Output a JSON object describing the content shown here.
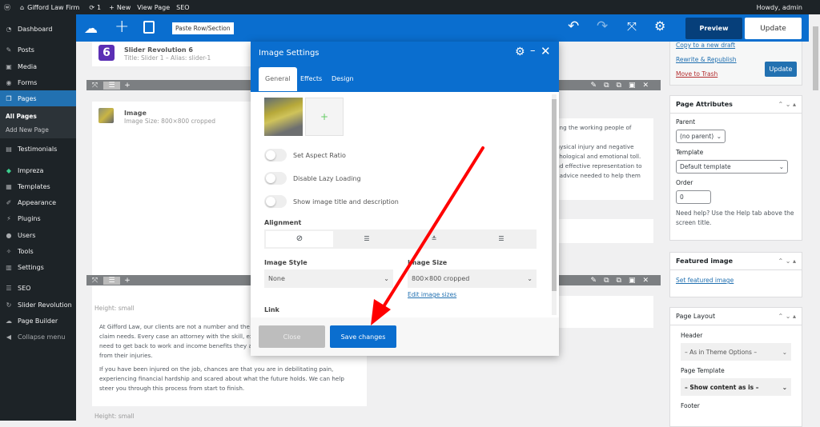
{
  "adminbar": {
    "site": "Gifford Law Firm",
    "updates": "1",
    "new": "New",
    "view": "View Page",
    "seo": "SEO",
    "howdy": "Howdy, admin"
  },
  "sidebar": {
    "items": [
      {
        "label": "Dashboard",
        "icon": "dashboard-icon"
      },
      {
        "label": "Posts",
        "icon": "pin-icon"
      },
      {
        "label": "Media",
        "icon": "media-icon"
      },
      {
        "label": "Forms",
        "icon": "forms-icon"
      },
      {
        "label": "Pages",
        "icon": "pages-icon"
      },
      {
        "label": "Testimonials",
        "icon": "testimonials-icon"
      },
      {
        "label": "Impreza",
        "icon": "diamond-icon"
      },
      {
        "label": "Templates",
        "icon": "templates-icon"
      },
      {
        "label": "Appearance",
        "icon": "brush-icon"
      },
      {
        "label": "Plugins",
        "icon": "plugin-icon"
      },
      {
        "label": "Users",
        "icon": "users-icon"
      },
      {
        "label": "Tools",
        "icon": "wrench-icon"
      },
      {
        "label": "Settings",
        "icon": "settings-icon"
      },
      {
        "label": "SEO",
        "icon": "seo-icon"
      },
      {
        "label": "Slider Revolution",
        "icon": "slider-icon"
      },
      {
        "label": "Page Builder",
        "icon": "builder-icon"
      },
      {
        "label": "Collapse menu",
        "icon": "collapse-icon"
      }
    ],
    "sub": [
      "All Pages",
      "Add New Page"
    ]
  },
  "toolbar": {
    "paste": "Paste Row/Section",
    "preview": "Preview",
    "update": "Update",
    "accent": "#0a6ecf"
  },
  "canvas": {
    "slider": {
      "title": "Slider Revolution 6",
      "sub": "Title: Slider 1 – Alias: slider-1",
      "badge": "6"
    },
    "image": {
      "title": "Image",
      "sub": "Image Size: 800×800 cropped"
    },
    "right_text": [
      "sting the working people of",
      "physical injury and negative",
      "ychological and emotional toll.",
      "and effective representation to",
      "al advice needed to help them"
    ],
    "height_label": "Height: small",
    "para1": "At Gifford Law, our clients are not a number and the foc the individualized attention their claim needs. Every case an attorney with the skill, experience and reputation to h they need to get back to work and income benefits they are entitled to while they recover from their injuries.",
    "para2": "If you have been injured on the job, chances are that you are in debilitating pain, experiencing financial hardship and scared about what the future holds. We can help steer you through this process from start to finish.",
    "height_label2": "Height: small"
  },
  "modal": {
    "title": "Image Settings",
    "tabs": [
      "General",
      "Effects",
      "Design"
    ],
    "toggles": [
      "Set Aspect Ratio",
      "Disable Lazy Loading",
      "Show image title and description"
    ],
    "alignment": "Alignment",
    "style_label": "Image Style",
    "style_value": "None",
    "size_label": "Image Size",
    "size_value": "800×800 cropped",
    "edit_sizes": "Edit image sizes",
    "link": "Link",
    "close": "Close",
    "save": "Save changes"
  },
  "right": {
    "copy": "Copy to a new draft",
    "rewrite": "Rewrite & Republish",
    "trash": "Move to Trash",
    "update": "Update",
    "attrs": {
      "title": "Page Attributes",
      "parent_label": "Parent",
      "parent": "(no parent)",
      "template_label": "Template",
      "template": "Default template",
      "order_label": "Order",
      "order": "0",
      "help": "Need help? Use the Help tab above the screen title."
    },
    "featured": {
      "title": "Featured image",
      "link": "Set featured image"
    },
    "layout": {
      "title": "Page Layout",
      "header_label": "Header",
      "header": "– As in Theme Options –",
      "tpl_label": "Page Template",
      "tpl": "– Show content as is –",
      "footer_label": "Footer"
    }
  },
  "annotation_color": "#ff0000"
}
